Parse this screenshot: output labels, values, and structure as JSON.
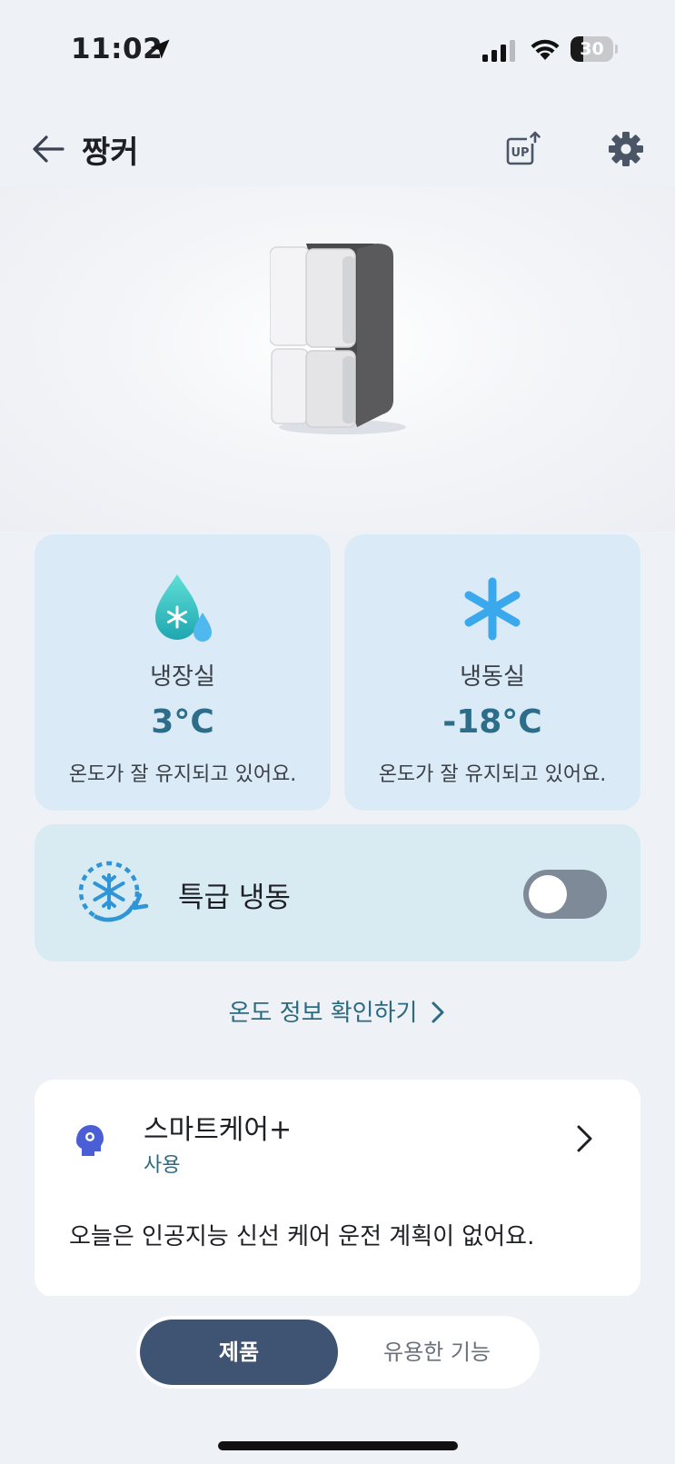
{
  "status_bar": {
    "time": "11:02",
    "battery": "30",
    "battery_level_percent": 30,
    "icons": [
      "location-arrow-icon",
      "cellular-signal-icon",
      "wifi-icon",
      "battery-icon"
    ]
  },
  "header": {
    "title": "짱커",
    "icons": [
      "back-arrow-icon",
      "upgrade-icon",
      "gear-icon"
    ]
  },
  "fridge_compartment": {
    "label": "냉장실",
    "temperature": "3°C",
    "status": "온도가 잘 유지되고 있어요.",
    "icon": "water-drop-snowflake-icon"
  },
  "freezer_compartment": {
    "label": "냉동실",
    "temperature": "-18°C",
    "status": "온도가 잘 유지되고 있어요.",
    "icon": "snowflake-icon"
  },
  "express_freeze": {
    "label": "특급 냉동",
    "enabled": false,
    "icon": "express-freeze-icon"
  },
  "temperature_link": {
    "label": "온도 정보 확인하기"
  },
  "smartcare": {
    "title": "스마트케어+",
    "status": "사용",
    "message": "오늘은 인공지능 신선 케어 운전 계획이 없어요.",
    "icon": "smartcare-head-icon"
  },
  "bottom_tabs": {
    "items": [
      {
        "label": "제품",
        "active": true
      },
      {
        "label": "유용한 기능",
        "active": false
      }
    ]
  },
  "colors": {
    "background": "#eef1f6",
    "card_blue": "#daeaf6",
    "accent_teal": "#2c6d8a",
    "tab_active": "#3f5373",
    "toggle_off": "#7f8a98"
  }
}
